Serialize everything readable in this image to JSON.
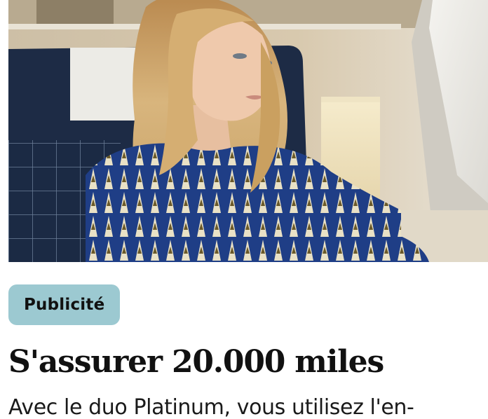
{
  "ad": {
    "badge_label": "Publicité",
    "title": "S'assurer 20.000 miles",
    "description": "Avec le duo Platinum, vous utilisez l'en-"
  },
  "colors": {
    "badge_background": "#9cc9d1",
    "text": "#111111",
    "page_background": "#ffffff"
  }
}
